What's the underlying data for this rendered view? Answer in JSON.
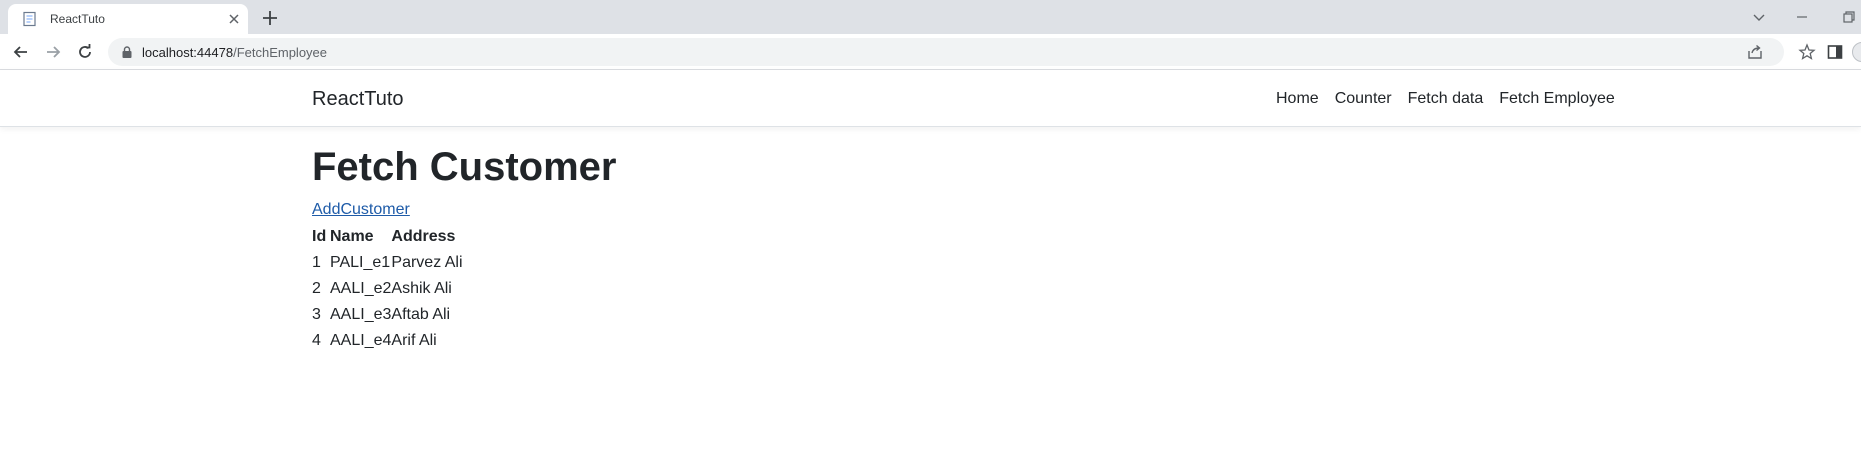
{
  "browser": {
    "tab_title": "ReactTuto",
    "url_host": "localhost:44478",
    "url_path": "/FetchEmployee",
    "icons": [
      "page-favicon-icon",
      "close-icon",
      "plus-icon",
      "chevron-down-icon",
      "minimize-icon",
      "restore-icon",
      "back-arrow-icon",
      "forward-arrow-icon",
      "reload-icon",
      "lock-icon",
      "share-icon",
      "star-icon",
      "side-panel-icon"
    ]
  },
  "navbar": {
    "brand": "ReactTuto",
    "links": [
      "Home",
      "Counter",
      "Fetch data",
      "Fetch Employee"
    ]
  },
  "main": {
    "title": "Fetch Customer",
    "add_link": "AddCustomer",
    "table": {
      "headers": [
        "Id",
        "Name",
        "Address"
      ],
      "rows": [
        [
          "1",
          "PALI_e1",
          "Parvez Ali"
        ],
        [
          "2",
          "AALI_e2",
          "Ashik Ali"
        ],
        [
          "3",
          "AALI_e3",
          "Aftab Ali"
        ],
        [
          "4",
          "AALI_e4",
          "Arif Ali"
        ]
      ]
    }
  },
  "colors": {
    "tabstrip": "#dee1e6",
    "omnibox": "#f1f3f4",
    "text": "#212529",
    "link": "#1e5ba8"
  }
}
